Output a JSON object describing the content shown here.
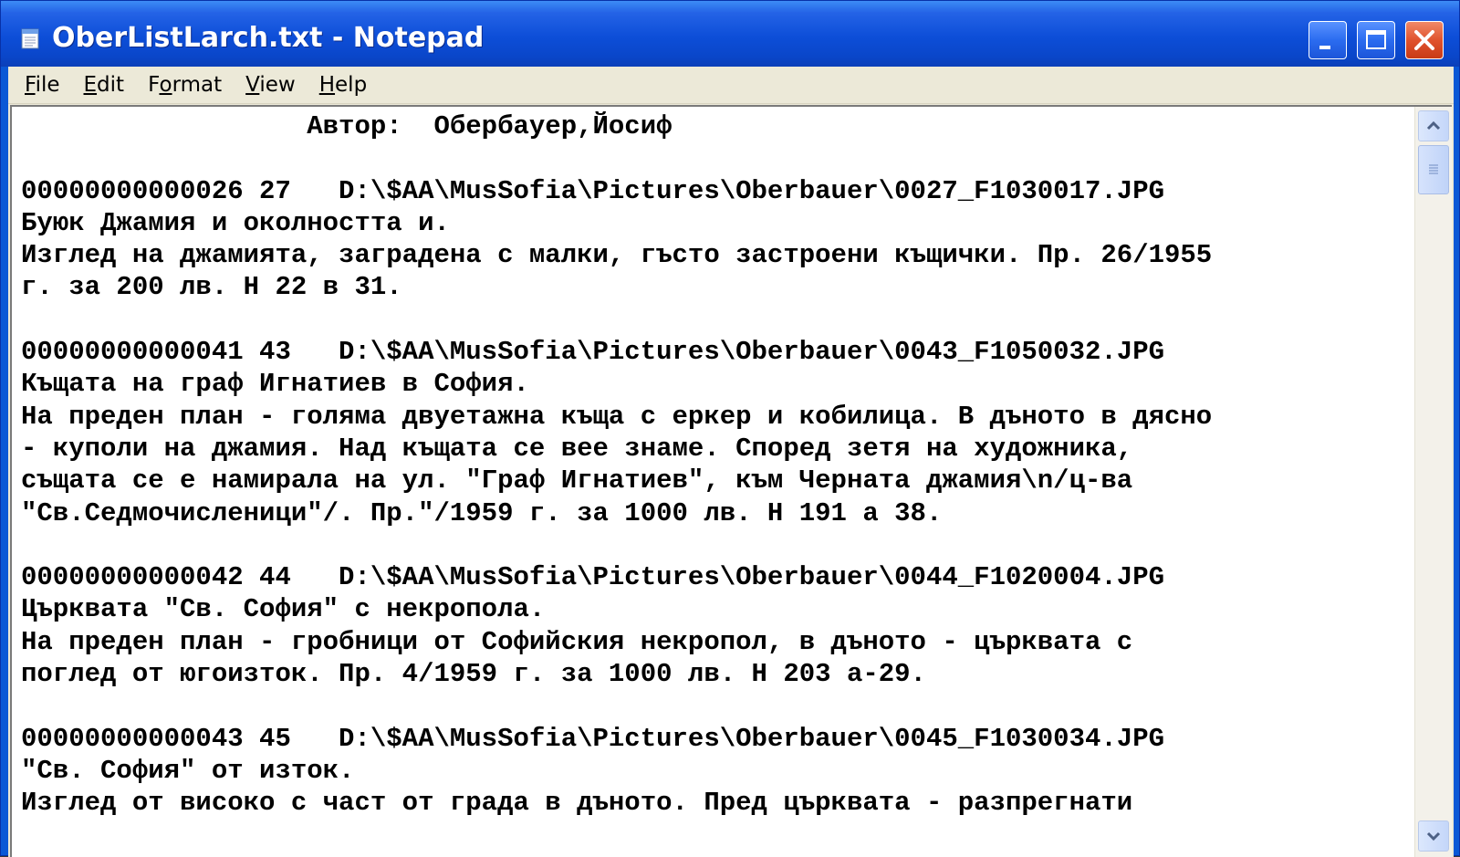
{
  "window": {
    "title": "OberListLarch.txt - Notepad",
    "icon": "notepad-icon",
    "controls": [
      "minimize-icon",
      "maximize-icon",
      "close-icon"
    ]
  },
  "menu": {
    "items": [
      {
        "label": "File",
        "accel": "F"
      },
      {
        "label": "Edit",
        "accel": "E"
      },
      {
        "label": "Format",
        "accel": "o"
      },
      {
        "label": "View",
        "accel": "V"
      },
      {
        "label": "Help",
        "accel": "H"
      }
    ]
  },
  "document": {
    "lines": [
      "                  Автор:  Обербауер,Йосиф",
      "",
      "00000000000026 27   D:\\$AA\\MusSofia\\Pictures\\Oberbauer\\0027_F1030017.JPG",
      "Буюк Джамия и околността и.",
      "Изглед на джамията, заградена с малки, гъсто застроени къщички. Пр. 26/1955",
      "г. за 200 лв. Н 22 в 31.",
      "",
      "00000000000041 43   D:\\$AA\\MusSofia\\Pictures\\Oberbauer\\0043_F1050032.JPG",
      "Къщата на граф Игнатиев в София.",
      "На преден план - голяма двуетажна къща с еркер и кобилица. В дъното в дясно",
      "- куполи на джамия. Над къщата се вее знаме. Според зетя на художника,",
      "същата се е намирала на ул. \"Граф Игнатиев\", към Черната джамия\\n/ц-ва",
      "\"Св.Седмочисленици\"/. Пр.\"/1959 г. за 1000 лв. Н 191 а 38.",
      "",
      "00000000000042 44   D:\\$AA\\MusSofia\\Pictures\\Oberbauer\\0044_F1020004.JPG",
      "Църквата \"Св. София\" с некропола.",
      "На преден план - гробници от Софийския некропол, в дъното - църквата с",
      "поглед от югоизток. Пр. 4/1959 г. за 1000 лв. Н 203 а-29.",
      "",
      "00000000000043 45   D:\\$AA\\MusSofia\\Pictures\\Oberbauer\\0045_F1030034.JPG",
      "\"Св. София\" от изток.",
      "Изглед от високо с част от града в дъното. Пред църквата - разпрегнати"
    ]
  },
  "scrollbar": {
    "up_icon": "scroll-up-arrow-icon",
    "down_icon": "scroll-down-arrow-icon"
  },
  "colors": {
    "titlebar": "#0a46c9",
    "close_button": "#e0532e",
    "menubar": "#ece9d8",
    "editor_background": "#ffffff",
    "text": "#000000"
  }
}
